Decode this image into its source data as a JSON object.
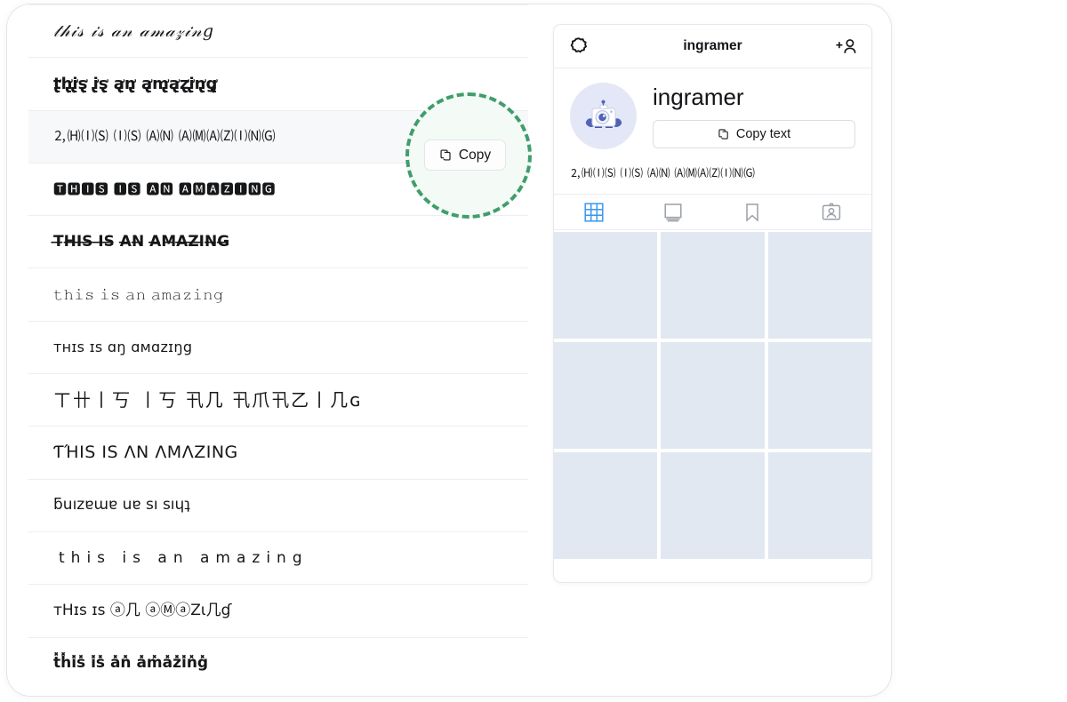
{
  "source_text": "this is an amazing",
  "colors": {
    "highlight_ring": "#3f9e6b",
    "highlight_fill": "#f4faf6",
    "active_tab": "#3897f0",
    "grid_placeholder": "#e2e8f1",
    "row_hover": "#f7f8f9"
  },
  "font_list": {
    "rows": [
      {
        "id": "script",
        "sample": "𝓉𝒽𝒾𝓈 𝒾𝓈 𝒶𝓃 𝒶𝓂𝒶𝓏𝒾𝓃𝑔",
        "plain": "this is an amazing",
        "hovered": false
      },
      {
        "id": "messy",
        "sample": "t̢̛͎h̢̛͎i̢̛͎s̢̛͎ i̢̛͎s̢̛͎ a̢̛͎n̢̛͎ a̢̛͎m̢̛͎a̢̛͎z̢̛͎i̢̛͎n̢̛͎g̢̛͎",
        "plain": "this is an amazing",
        "hovered": false
      },
      {
        "id": "squared-white",
        "sample": "🄃🄗🄘🄢 🄘🄢 🄐🄝 🄐🄜🄐🄩🄘🄝🄖",
        "plain": "THIS IS AN AMAZING",
        "hovered": true
      },
      {
        "id": "squared-black",
        "sample": "🆃🅷🅸🆂 🅸🆂 🅰🅽 🅰🅼🅰🆉🅸🅽🅶",
        "plain": "THIS IS AN AMAZING",
        "hovered": false
      },
      {
        "id": "strikethrough",
        "sample": "T̶H̶I̶S̶ I̶S̶ A̶N̶ A̶M̶A̶Z̶I̶N̶G̶",
        "plain": "THIS IS AN AMAZING",
        "hovered": false
      },
      {
        "id": "typewriter",
        "sample": "𝚝𝚑𝚒𝚜 𝚒𝚜 𝚊𝚗 𝚊𝚖𝚊𝚣𝚒𝚗𝚐",
        "plain": "this is an amazing",
        "hovered": false
      },
      {
        "id": "small-caps",
        "sample": "ᴛʜɪs ɪs ɑŋ ɑмɑzɪŋg",
        "plain": "THIS IS AN AMAZING",
        "hovered": false
      },
      {
        "id": "cjk-glyph",
        "sample": "ㄒ卄丨丂 丨丂 卂几 卂爪卂乙丨几ɢ",
        "plain": "THIS IS AN AMAZING",
        "hovered": false
      },
      {
        "id": "stencil",
        "sample": "ƬΉIS IS ΛN ΛMΛZING",
        "plain": "THIS IS AN AMAZING",
        "hovered": false
      },
      {
        "id": "upside-down",
        "sample": "ƃuızɐɯɐ uɐ sı sıɥʇ",
        "plain": "this is an amazing",
        "hovered": false
      },
      {
        "id": "wide-spaced",
        "sample": "this is an amazing",
        "plain": "this is an amazing",
        "hovered": false
      },
      {
        "id": "mixed-circled",
        "sample": "ᴛHɪs ɪs ⓐ几 ⓐⓂⓐZι几ɠ",
        "plain": "THIS IS AN AMAZING",
        "hovered": false
      },
      {
        "id": "cross-marks",
        "sample": "t̽h̽i̽s̽ i̽s̽ a̽n̽ a̽m̽a̽z̽i̽n̽g̽",
        "plain": "this is an amazing",
        "hovered": false
      }
    ]
  },
  "copy_button": {
    "label": "Copy",
    "icon": "copy-icon"
  },
  "phone": {
    "header": {
      "title": "ingramer",
      "left_icon": "settings-gear-icon",
      "right_icon": "add-person-icon"
    },
    "profile": {
      "username": "ingramer",
      "avatar_alt": "camera-illustration-avatar",
      "copy_text_label": "Copy text",
      "copy_text_icon": "copy-icon",
      "bio": "🄃🄗🄘🄢 🄘🄢 🄐🄝 🄐🄜🄐🄩🄘🄝🄖"
    },
    "tabs": [
      {
        "id": "grid",
        "icon": "grid-icon",
        "active": true
      },
      {
        "id": "reels",
        "icon": "reels-icon",
        "active": false
      },
      {
        "id": "saved",
        "icon": "bookmark-icon",
        "active": false
      },
      {
        "id": "tagged",
        "icon": "tagged-icon",
        "active": false
      }
    ],
    "grid_cells": 9
  }
}
